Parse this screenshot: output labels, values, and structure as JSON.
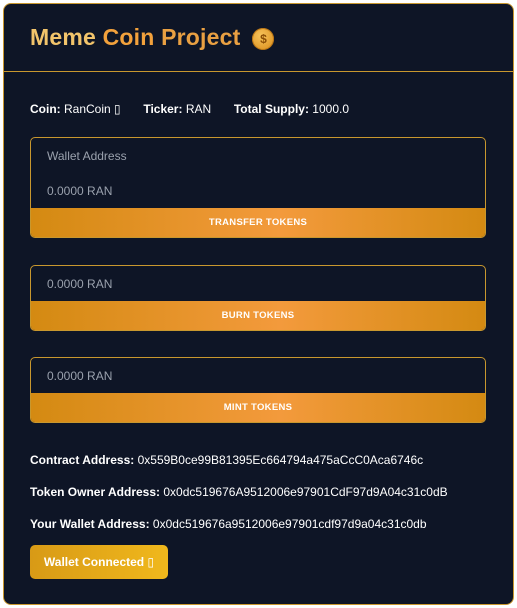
{
  "header": {
    "title_word1": "Meme",
    "title_word2": "Coin",
    "title_word3": "Project",
    "coin_icon_glyph": "$"
  },
  "info": {
    "coin_label": "Coin:",
    "coin_value": "RanCoin ▯",
    "ticker_label": "Ticker:",
    "ticker_value": "RAN",
    "supply_label": "Total Supply:",
    "supply_value": "1000.0"
  },
  "transfer": {
    "address_placeholder": "Wallet Address",
    "amount_placeholder": "0.0000 RAN",
    "button_label": "TRANSFER TOKENS"
  },
  "burn": {
    "amount_placeholder": "0.0000 RAN",
    "button_label": "BURN TOKENS"
  },
  "mint": {
    "amount_placeholder": "0.0000 RAN",
    "button_label": "MINT TOKENS"
  },
  "addresses": {
    "contract_label": "Contract Address:",
    "contract_value": "0x559B0ce99B81395Ec664794a475aCcC0Aca6746c",
    "owner_label": "Token Owner Address:",
    "owner_value": "0x0dc519676A9512006e97901CdF97d9A04c31c0dB",
    "wallet_label": "Your Wallet Address:",
    "wallet_value": "0x0dc519676a9512006e97901cdf97d9a04c31c0db"
  },
  "wallet_button": {
    "label": "Wallet Connected ▯"
  },
  "colors": {
    "background": "#0e1526",
    "border": "#c8972e",
    "accent": "#f39a3c"
  }
}
